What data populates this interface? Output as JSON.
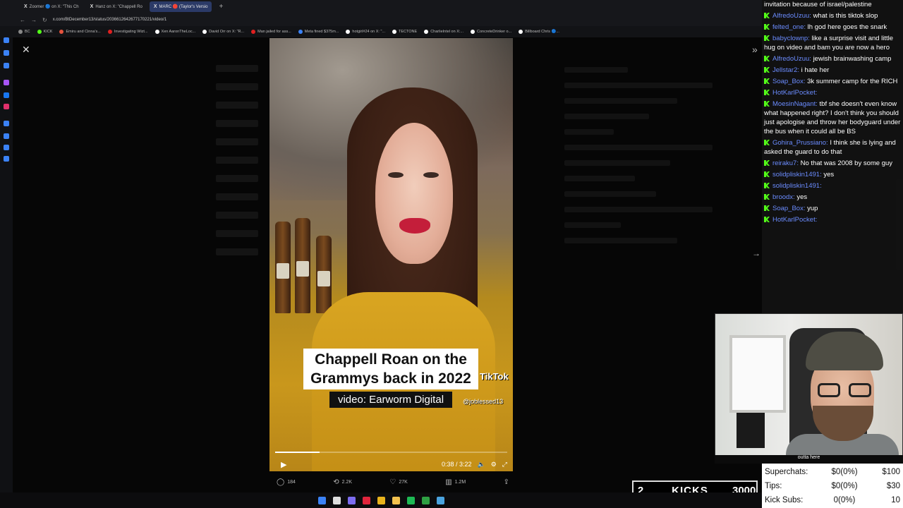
{
  "browser": {
    "tabs": [
      {
        "label": "Zoomer 🔵 on X: \"This Ch",
        "active": false
      },
      {
        "label": "Hanz on X: \"Chappell Ro",
        "active": false
      },
      {
        "label": "MARC 🛑 (Taylor's Versio",
        "active": true
      }
    ],
    "new_tab": "+",
    "url": "x.com/BtDecember13/status/2036612642677170221/video/1",
    "bookmarks": [
      {
        "label": "BC",
        "color": "#888888"
      },
      {
        "label": "KICK",
        "color": "#53fc18"
      },
      {
        "label": "Emiru and Cinna's...",
        "color": "#e5533d"
      },
      {
        "label": "Investigating Wizt...",
        "color": "#e02020"
      },
      {
        "label": "Xen AaronTheLoc...",
        "color": "#ffffff"
      },
      {
        "label": "David Orr on X: \"R...",
        "color": "#ffffff"
      },
      {
        "label": "Man jailed for ass...",
        "color": "#e02020"
      },
      {
        "label": "Meta fined $375m...",
        "color": "#3b82f6"
      },
      {
        "label": "hotgirl#24 on X: \"...",
        "color": "#ffffff"
      },
      {
        "label": "TECTONE",
        "color": "#ffffff"
      },
      {
        "label": "CharlieIntel on X:...",
        "color": "#ffffff"
      },
      {
        "label": "ConcreteDrinker o...",
        "color": "#ffffff"
      },
      {
        "label": "Billboard Chris 🔵...",
        "color": "#ffffff"
      }
    ]
  },
  "video": {
    "caption_line1": "Chappell Roan on the",
    "caption_line2": "Grammys back in 2022",
    "caption_sub": "video: Earworm Digital",
    "watermark": "TikTok",
    "handle": "@joblessed13",
    "time": "0:38 / 3:22",
    "progress": 0.19
  },
  "post_actions": [
    {
      "icon": "reply-icon",
      "glyph": "◯",
      "count": "184"
    },
    {
      "icon": "retweet-icon",
      "glyph": "⟲",
      "count": "2.2K"
    },
    {
      "icon": "heart-icon",
      "glyph": "♡",
      "count": "27K"
    },
    {
      "icon": "views-icon",
      "glyph": "▥",
      "count": "1.2M"
    }
  ],
  "chat": [
    {
      "user": "",
      "text": "invitation because of israel/palestine"
    },
    {
      "user": "AlfredoUzuu:",
      "text": "what is this tiktok slop"
    },
    {
      "user": "felted_one:",
      "text": "lh god here goes the snark"
    },
    {
      "user": "babyclownp:",
      "text": "like a surprise visit and little hug on video and bam you are now a hero"
    },
    {
      "user": "AlfredoUzuu:",
      "text": "jewish brainwashing camp"
    },
    {
      "user": "Jellstar2:",
      "text": "i hate her"
    },
    {
      "user": "Soap_Box:",
      "text": "3k summer camp for the RICH"
    },
    {
      "user": "HotKarlPocket:",
      "text": ""
    },
    {
      "user": "MoesinNagant:",
      "text": "tbf she doesn't even know what happened right? I don't think you should just apologise and throw her bodyguard under the bus when it could all be BS"
    },
    {
      "user": "Gohira_Prussiano:",
      "text": "I think she is lying and asked the guard to do that"
    },
    {
      "user": "reiraku7:",
      "text": "No that was 2008 by some guy"
    },
    {
      "user": "solidpliskin1491:",
      "text": "yes"
    },
    {
      "user": "solidpliskin1491:",
      "text": ""
    },
    {
      "user": "broodx:",
      "text": "yes"
    },
    {
      "user": "Soap_Box:",
      "text": "yup"
    },
    {
      "user": "HotKarlPocket:",
      "text": ""
    }
  ],
  "webcam_caption": "outta here",
  "kicks": {
    "count": "2",
    "label": "KICKS",
    "target": "3000"
  },
  "stats": [
    {
      "label": "Superchats:",
      "value": "$0(0%)",
      "target": "$100"
    },
    {
      "label": "Tips:",
      "value": "$0(0%)",
      "target": "$30"
    },
    {
      "label": "Kick Subs:",
      "value": "0(0%)",
      "target": "10"
    }
  ],
  "taskbar_icons": [
    {
      "name": "windows-start-icon",
      "color": "#3b82f6"
    },
    {
      "name": "search-icon",
      "color": "#dddddd"
    },
    {
      "name": "discord-icon",
      "color": "#7c6cf0"
    },
    {
      "name": "opera-icon",
      "color": "#e0243c"
    },
    {
      "name": "chrome-icon",
      "color": "#e8b31c"
    },
    {
      "name": "folder-icon",
      "color": "#f2c14e"
    },
    {
      "name": "spotify-icon",
      "color": "#1db954"
    },
    {
      "name": "xbox-icon",
      "color": "#2ea043"
    },
    {
      "name": "steam-icon",
      "color": "#4aa3df"
    }
  ]
}
